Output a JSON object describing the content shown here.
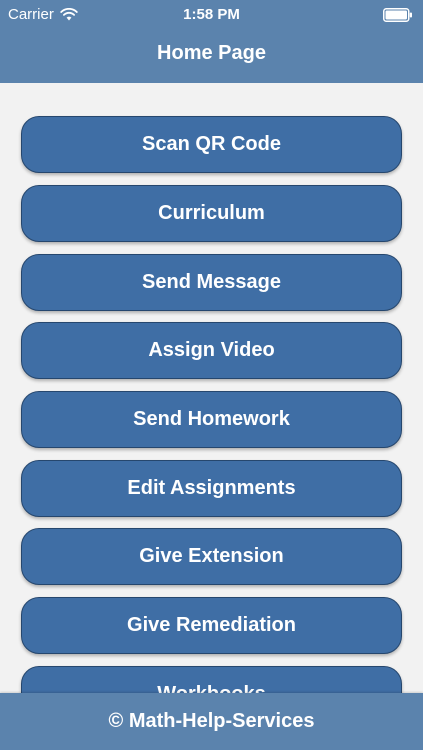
{
  "status_bar": {
    "carrier": "Carrier",
    "time": "1:58 PM",
    "wifi_icon": "wifi-icon",
    "battery_icon": "battery-icon"
  },
  "nav": {
    "title": "Home Page"
  },
  "menu": {
    "buttons": [
      "Scan QR Code",
      "Curriculum",
      "Send Message",
      "Assign Video",
      "Send Homework",
      "Edit Assignments",
      "Give Extension",
      "Give Remediation",
      "Workbooks"
    ]
  },
  "footer": {
    "text": "© Math-Help-Services"
  },
  "colors": {
    "bar": "#5b83ad",
    "button": "#3f6ea5",
    "button_border": "#26476e",
    "background": "#f2f2f2"
  }
}
